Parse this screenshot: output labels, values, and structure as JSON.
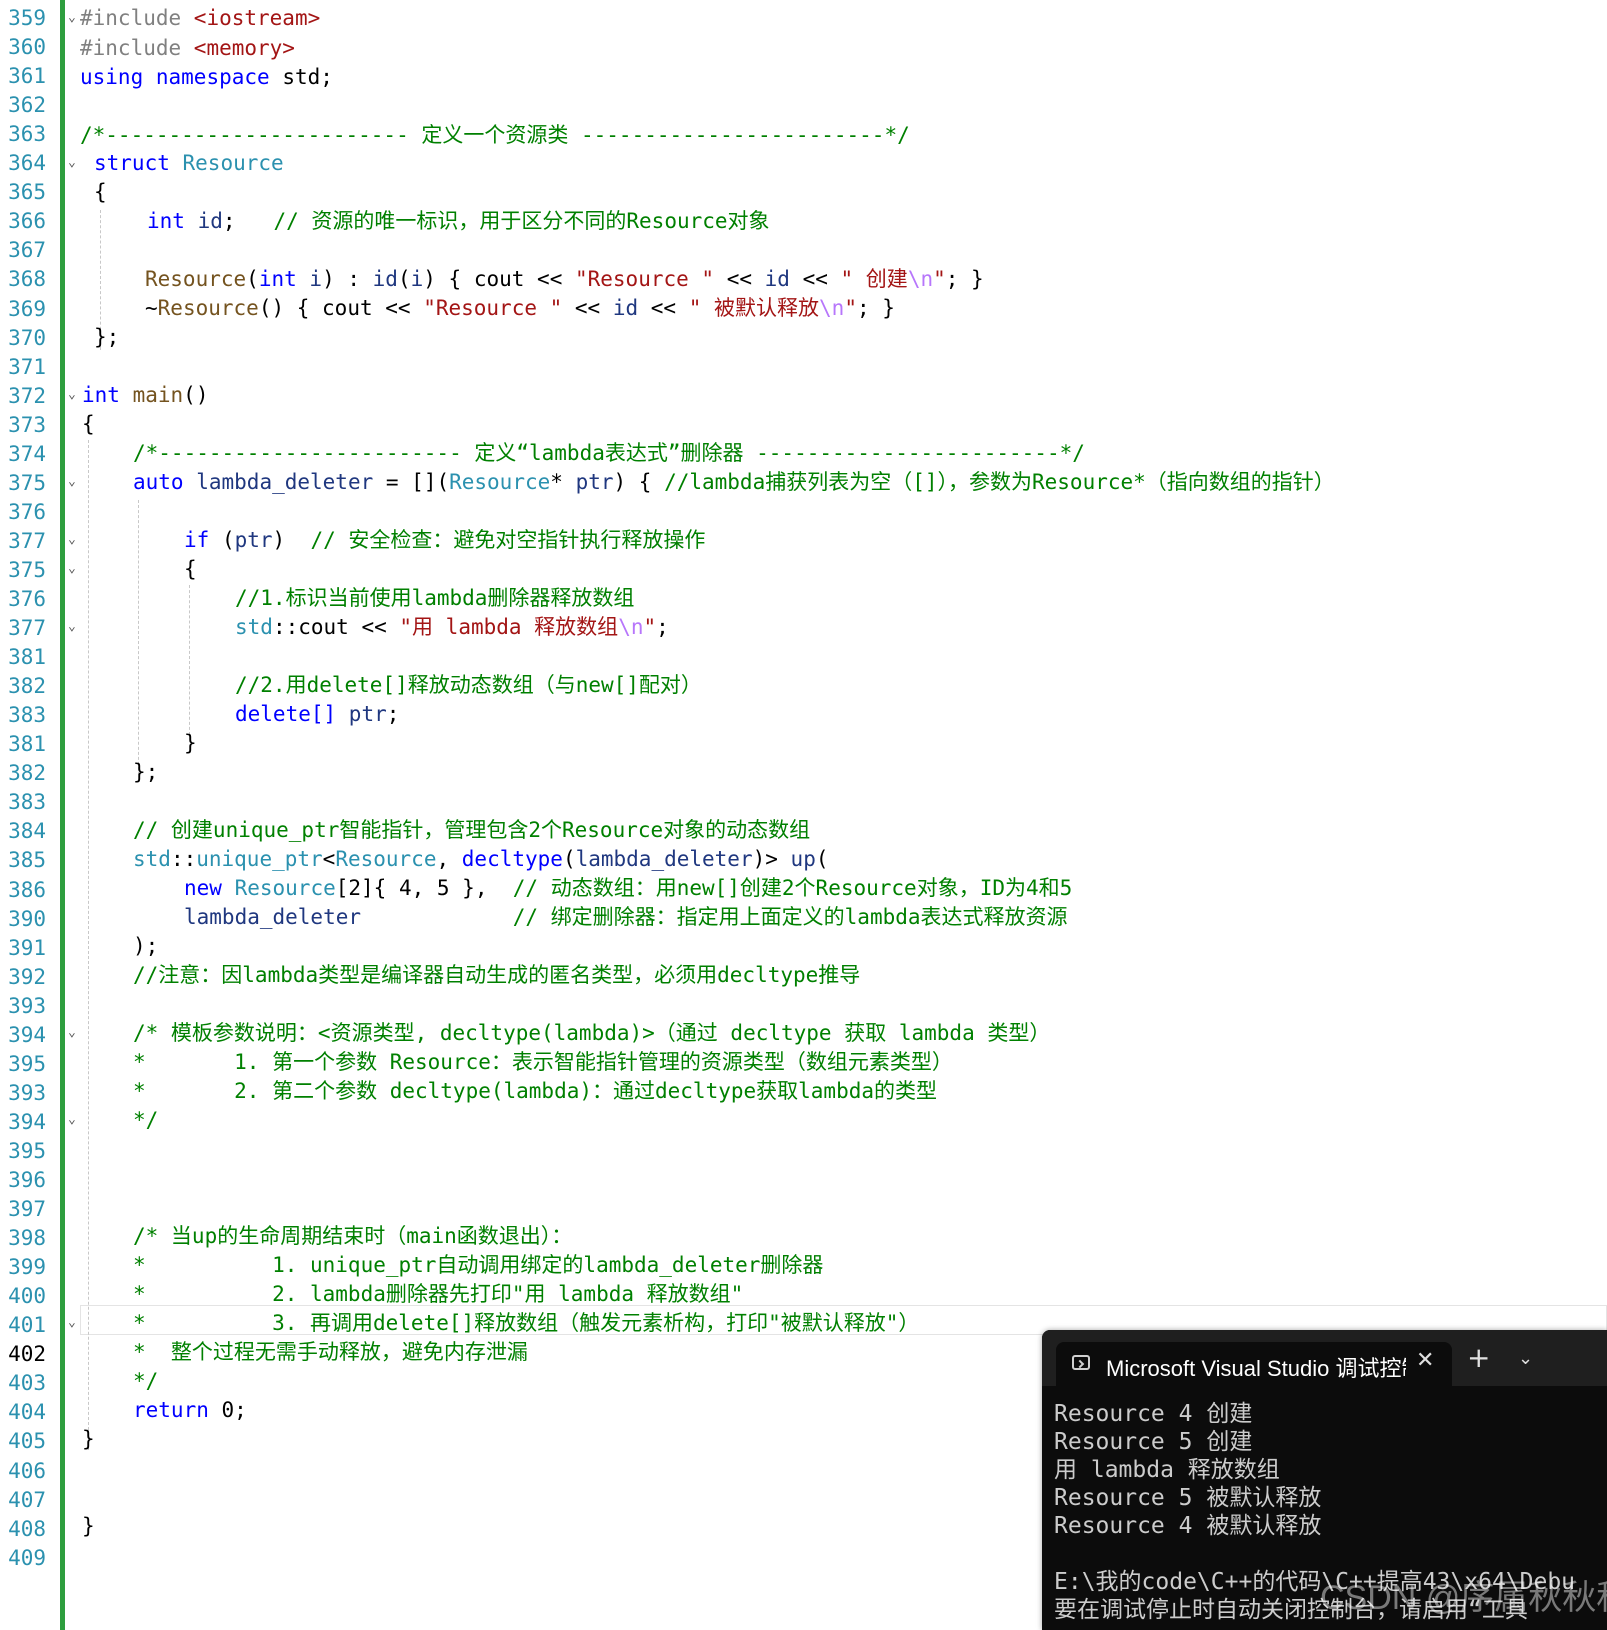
{
  "editor": {
    "current_line": "402",
    "lines": [
      {
        "num": "359"
      },
      {
        "num": "360"
      },
      {
        "num": "361"
      },
      {
        "num": "362"
      },
      {
        "num": "363"
      },
      {
        "num": "364"
      },
      {
        "num": "365"
      },
      {
        "num": "366"
      },
      {
        "num": "367"
      },
      {
        "num": "368"
      },
      {
        "num": "369"
      },
      {
        "num": "370"
      },
      {
        "num": "371"
      },
      {
        "num": "372"
      },
      {
        "num": "373"
      },
      {
        "num": "374"
      },
      {
        "num": "375"
      },
      {
        "num": "376"
      },
      {
        "num": "377"
      },
      {
        "num": "375"
      },
      {
        "num": "376"
      },
      {
        "num": "377"
      },
      {
        "num": "381"
      },
      {
        "num": "382"
      },
      {
        "num": "383"
      },
      {
        "num": "381"
      },
      {
        "num": "382"
      },
      {
        "num": "383"
      },
      {
        "num": "384"
      },
      {
        "num": "385"
      },
      {
        "num": "386"
      },
      {
        "num": "390"
      },
      {
        "num": "391"
      },
      {
        "num": "392"
      },
      {
        "num": "393"
      },
      {
        "num": "394"
      },
      {
        "num": "395"
      },
      {
        "num": "393"
      },
      {
        "num": "394"
      },
      {
        "num": "395"
      },
      {
        "num": "396"
      },
      {
        "num": "397"
      },
      {
        "num": "398"
      },
      {
        "num": "399"
      },
      {
        "num": "400"
      },
      {
        "num": "401"
      },
      {
        "num": "402"
      },
      {
        "num": "403"
      },
      {
        "num": "404"
      },
      {
        "num": "405"
      },
      {
        "num": "406"
      },
      {
        "num": "407"
      },
      {
        "num": "408"
      },
      {
        "num": "409"
      }
    ],
    "code": {
      "l0": [
        "#include ",
        "<iostream>"
      ],
      "l1": [
        "#include ",
        "<memory>"
      ],
      "l2": [
        "using",
        " ",
        "namespace",
        " std;"
      ],
      "l4": [
        "/*------------------------ 定义一个资源类 ------------------------*/"
      ],
      "l5": [
        "struct",
        " ",
        "Resource"
      ],
      "l6": [
        "{"
      ],
      "l7": [
        "int",
        " ",
        "id",
        ";   ",
        "// 资源的唯一标识，用于区分不同的Resource对象"
      ],
      "l9": [
        "Resource",
        "(",
        "int",
        " ",
        "i",
        ") : ",
        "id",
        "(",
        "i",
        ") { ",
        "cout",
        " << ",
        "\"Resource \"",
        " << ",
        "id",
        " << ",
        "\" 创建",
        "\\n",
        "\"",
        "; }"
      ],
      "l10": [
        "~",
        "Resource",
        "() { ",
        "cout",
        " << ",
        "\"Resource \"",
        " << ",
        "id",
        " << ",
        "\" 被默认释放",
        "\\n",
        "\"",
        "; }"
      ],
      "l11": [
        "};"
      ],
      "l13": [
        "int",
        " ",
        "main",
        "()"
      ],
      "l14": [
        "{"
      ],
      "l15": [
        "/*------------------------ 定义“lambda表达式”删除器 ------------------------*/"
      ],
      "l16": [
        "auto",
        " ",
        "lambda_deleter",
        " = [](",
        "Resource",
        "* ",
        "ptr",
        ") { ",
        "//lambda捕获列表为空（[]），参数为Resource*（指向数组的指针）"
      ],
      "l18": [
        "if",
        " (",
        "ptr",
        ")  ",
        "// 安全检查：避免对空指针执行释放操作"
      ],
      "l19": [
        "{"
      ],
      "l20": [
        "//1.标识当前使用lambda删除器释放数组"
      ],
      "l21": [
        "std",
        "::",
        "cout",
        " << ",
        "\"用 lambda 释放数组",
        "\\n",
        "\"",
        ";"
      ],
      "l23": [
        "//2.用delete[]释放动态数组（与new[]配对）"
      ],
      "l24": [
        "delete",
        "[] ",
        "ptr",
        ";"
      ],
      "l25": [
        "}"
      ],
      "l26": [
        "};"
      ],
      "l28": [
        "// 创建unique_ptr智能指针，管理包含2个Resource对象的动态数组"
      ],
      "l29": [
        "std",
        "::",
        "unique_ptr",
        "<",
        "Resource",
        ", ",
        "decltype",
        "(",
        "lambda_deleter",
        ")> ",
        "up",
        "("
      ],
      "l30": [
        "new",
        " ",
        "Resource",
        "[2]{ 4, 5 },  ",
        "// 动态数组：用new[]创建2个Resource对象，ID为4和5"
      ],
      "l31": [
        "lambda_deleter",
        "            ",
        "// 绑定删除器：指定用上面定义的lambda表达式释放资源"
      ],
      "l32": [
        ");"
      ],
      "l33": [
        "//注意：因lambda类型是编译器自动生成的匿名类型，必须用decltype推导"
      ],
      "l35": [
        "/* 模板参数说明：<资源类型, decltype(lambda)>（通过 decltype 获取 lambda 类型）"
      ],
      "l36": [
        "*       1. 第一个参数 Resource：表示智能指针管理的资源类型（数组元素类型）"
      ],
      "l37": [
        "*       2. 第二个参数 decltype(lambda)：通过decltype获取lambda的类型"
      ],
      "l38": [
        "*/"
      ],
      "l42": [
        "/* 当up的生命周期结束时（main函数退出）："
      ],
      "l43": [
        "*          1. unique_ptr自动调用绑定的lambda_deleter删除器"
      ],
      "l44": [
        "*          2. lambda删除器先打印\"用 lambda 释放数组\""
      ],
      "l45": [
        "*          3. 再调用delete[]释放数组（触发元素析构，打印\"被默认释放\"）"
      ],
      "l46": [
        "*  整个过程无需手动释放，避免内存泄漏"
      ],
      "l47": [
        "*/"
      ],
      "l48": [
        "return",
        " 0;"
      ],
      "l49": [
        "}"
      ],
      "l52": [
        "}"
      ]
    }
  },
  "console": {
    "tab_title": "Microsoft Visual Studio 调试控制台",
    "close_glyph": "✕",
    "new_tab_glyph": "+",
    "dropdown_glyph": "⌄",
    "output": [
      "Resource 4 创建",
      "Resource 5 创建",
      "用 lambda 释放数组",
      "Resource 5 被默认释放",
      "Resource 4 被默认释放",
      "",
      "E:\\我的code\\C++的代码\\C++提高43\\x64\\Debu",
      "要在调试停止时自动关闭控制台，请启用“工具"
    ]
  },
  "watermark": "CSDN @序属秋秋秋",
  "colors": {
    "keyword": "#0000ff",
    "string": "#a31515",
    "comment": "#008000",
    "type": "#2b91af",
    "line_number": "#2b91af",
    "change_bar": "#2e9e3e",
    "console_bg": "#0c0c0c"
  }
}
